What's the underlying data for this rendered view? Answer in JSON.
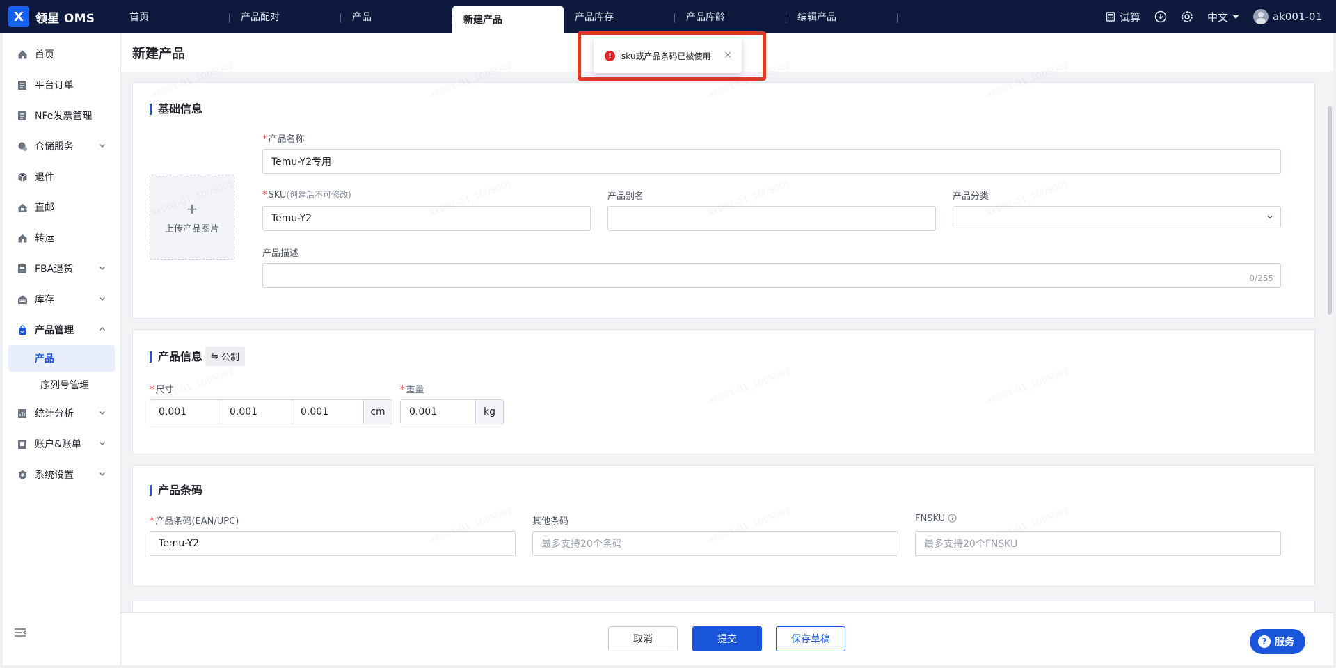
{
  "app": {
    "name": "领星 OMS",
    "logo_letter": "X"
  },
  "tabs": [
    {
      "label": "首页",
      "active": false
    },
    {
      "label": "产品配对",
      "active": false
    },
    {
      "label": "产品",
      "active": false
    },
    {
      "label": "新建产品",
      "active": true
    },
    {
      "label": "产品库存",
      "active": false
    },
    {
      "label": "产品库龄",
      "active": false
    },
    {
      "label": "编辑产品",
      "active": false
    }
  ],
  "topbar": {
    "calc_label": "试算",
    "language": "中文",
    "username": "ak001-01"
  },
  "sidebar": {
    "items": [
      {
        "label": "首页",
        "icon": "home-icon"
      },
      {
        "label": "平台订单",
        "icon": "order-icon"
      },
      {
        "label": "NFe发票管理",
        "icon": "invoice-icon"
      },
      {
        "label": "仓储服务",
        "icon": "warehouse-icon",
        "chevron": "down"
      },
      {
        "label": "退件",
        "icon": "return-icon"
      },
      {
        "label": "直邮",
        "icon": "mail-icon"
      },
      {
        "label": "转运",
        "icon": "transfer-icon"
      },
      {
        "label": "FBA退货",
        "icon": "fba-icon",
        "chevron": "down"
      },
      {
        "label": "库存",
        "icon": "stock-icon",
        "chevron": "down"
      },
      {
        "label": "产品管理",
        "icon": "product-icon",
        "chevron": "up"
      },
      {
        "label": "统计分析",
        "icon": "stats-icon",
        "chevron": "down"
      },
      {
        "label": "账户&账单",
        "icon": "account-icon",
        "chevron": "down"
      },
      {
        "label": "系统设置",
        "icon": "settings-icon",
        "chevron": "down"
      }
    ],
    "sub_items": [
      {
        "label": "产品",
        "active": true
      },
      {
        "label": "序列号管理",
        "active": false
      }
    ]
  },
  "page": {
    "title": "新建产品"
  },
  "basic": {
    "title": "基础信息",
    "upload_label": "上传产品图片",
    "name_label": "产品名称",
    "name_value": "Temu-Y2专用",
    "sku_label": "SKU",
    "sku_hint": "(创建后不可修改)",
    "sku_value": "Temu-Y2",
    "alias_label": "产品别名",
    "alias_value": "",
    "category_label": "产品分类",
    "category_value": "",
    "desc_label": "产品描述",
    "desc_counter": "0/255"
  },
  "product_info": {
    "title": "产品信息",
    "unit_toggle": "公制",
    "size_label": "尺寸",
    "length": "0.001",
    "width": "0.001",
    "height": "0.001",
    "size_unit": "cm",
    "weight_label": "重量",
    "weight": "0.001",
    "weight_unit": "kg"
  },
  "barcode": {
    "title": "产品条码",
    "ean_label": "产品条码(EAN/UPC)",
    "ean_value": "Temu-Y2",
    "other_label": "其他条码",
    "other_placeholder": "最多支持20个条码",
    "fnsku_label": "FNSKU",
    "fnsku_placeholder": "最多支持20个FNSKU"
  },
  "footer": {
    "cancel": "取消",
    "submit": "提交",
    "save_draft": "保存草稿",
    "service": "服务"
  },
  "toast": {
    "message": "sku或产品条码已被使用",
    "type": "error",
    "icon": "error-icon"
  },
  "watermark": "ak001-01_100S001",
  "colors": {
    "topbar": "#0d1a3d",
    "accent": "#1a56db",
    "error": "#e02424",
    "highlight": "#dc3b26"
  }
}
